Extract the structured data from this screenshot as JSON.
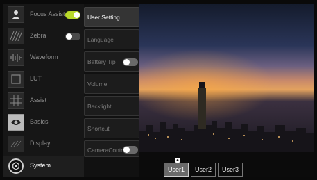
{
  "menu": {
    "items": [
      {
        "label": "Focus Assist",
        "icon": "person-icon",
        "toggle": "on"
      },
      {
        "label": "Zebra",
        "icon": "zebra-icon",
        "toggle": "off"
      },
      {
        "label": "Waveform",
        "icon": "waveform-icon"
      },
      {
        "label": "LUT",
        "icon": "lut-icon"
      },
      {
        "label": "Assist",
        "icon": "grid-icon"
      },
      {
        "label": "Basics",
        "icon": "eye-icon"
      },
      {
        "label": "Display",
        "icon": "display-icon"
      },
      {
        "label": "System",
        "icon": "system-icon",
        "active": true
      }
    ]
  },
  "submenu": {
    "items": [
      {
        "label": "User Setting",
        "active": true
      },
      {
        "label": "Language"
      },
      {
        "label": "Battery Tip",
        "toggle": "off"
      },
      {
        "label": "Volume"
      },
      {
        "label": "Backlight"
      },
      {
        "label": "Shortcut"
      },
      {
        "label": "CameraControl",
        "toggle": "off"
      }
    ]
  },
  "users": {
    "items": [
      {
        "label": "User1",
        "selected": true
      },
      {
        "label": "User2"
      },
      {
        "label": "User3"
      }
    ]
  },
  "colors": {
    "toggle_on": "#b8d82a",
    "toggle_off": "#4a4a4a"
  }
}
